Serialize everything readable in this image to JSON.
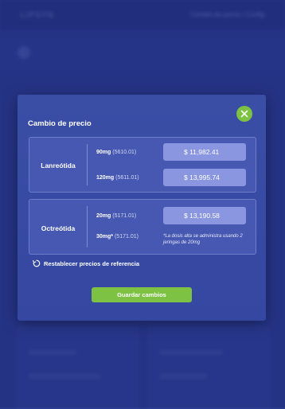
{
  "background": {
    "logo": "LIPSYN",
    "top_right": "Cambio de precio / Config"
  },
  "modal": {
    "title": "Cambio de precio",
    "close_icon": "close-icon",
    "products": [
      {
        "name": "Lanreótida",
        "doses": [
          {
            "dose": "90mg",
            "code": "(5610.01)",
            "price": "$ 11,982.41"
          },
          {
            "dose": "120mg",
            "code": "(5611.01)",
            "price": "$ 13,995.74"
          }
        ]
      },
      {
        "name": "Octreótida",
        "doses": [
          {
            "dose": "20mg",
            "code": "(5171.01)",
            "price": "$ 13,190.58"
          },
          {
            "dose": "30mg*",
            "code": "(5171.01)",
            "note": "*La dosis alta se administra usando 2 jeringas de 20mg"
          }
        ]
      }
    ],
    "reset_label": "Restablecer precios de referencia",
    "reset_icon": "refresh-icon",
    "save_label": "Guardar cambios"
  },
  "colors": {
    "background": "#2a3a8c",
    "modal": "#3a4da6",
    "accent_green": "#7dc242",
    "price_box": "#8a97e0"
  }
}
